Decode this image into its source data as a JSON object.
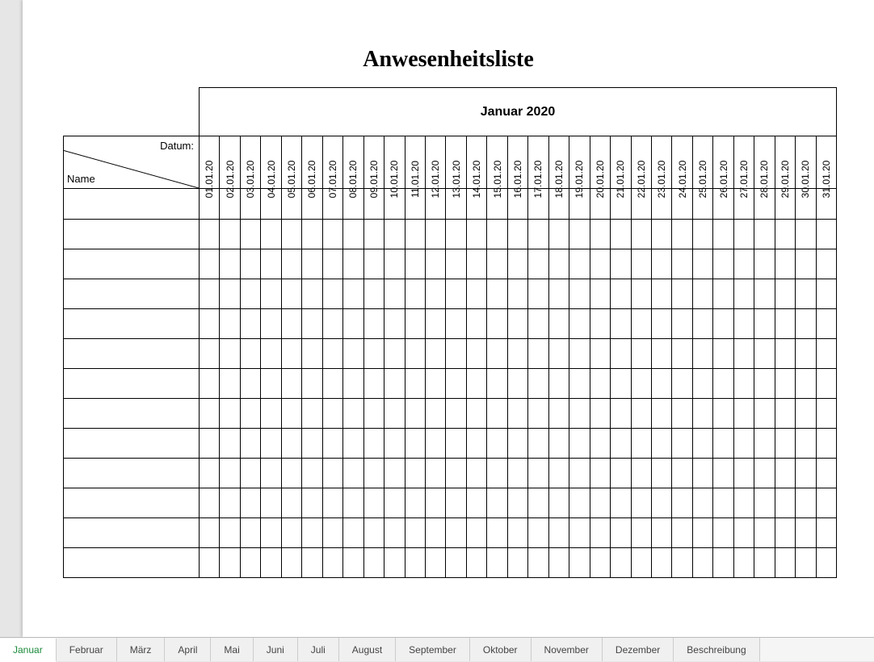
{
  "title": "Anwesenheitsliste",
  "month_label": "Januar 2020",
  "header": {
    "datum_label": "Datum:",
    "name_label": "Name"
  },
  "dates": [
    "01.01.20",
    "02.01.20",
    "03.01.20",
    "04.01.20",
    "05.01.20",
    "06.01.20",
    "07.01.20",
    "08.01.20",
    "09.01.20",
    "10.01.20",
    "11.01.20",
    "12.01.20",
    "13.01.20",
    "14.01.20",
    "15.01.20",
    "16.01.20",
    "17.01.20",
    "18.01.20",
    "19.01.20",
    "20.01.20",
    "21.01.20",
    "22.01.20",
    "23.01.20",
    "24.01.20",
    "25.01.20",
    "26.01.20",
    "27.01.20",
    "28.01.20",
    "29.01.20",
    "30.01.20",
    "31.01.20"
  ],
  "row_count": 13,
  "tabs": [
    {
      "label": "Januar",
      "active": true
    },
    {
      "label": "Februar",
      "active": false
    },
    {
      "label": "März",
      "active": false
    },
    {
      "label": "April",
      "active": false
    },
    {
      "label": "Mai",
      "active": false
    },
    {
      "label": "Juni",
      "active": false
    },
    {
      "label": "Juli",
      "active": false
    },
    {
      "label": "August",
      "active": false
    },
    {
      "label": "September",
      "active": false
    },
    {
      "label": "Oktober",
      "active": false
    },
    {
      "label": "November",
      "active": false
    },
    {
      "label": "Dezember",
      "active": false
    },
    {
      "label": "Beschreibung",
      "active": false
    }
  ]
}
